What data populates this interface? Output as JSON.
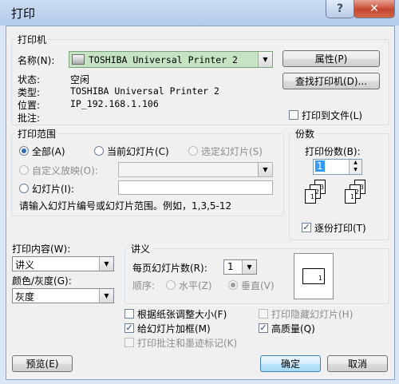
{
  "window": {
    "title": "打印"
  },
  "printer": {
    "group_label": "打印机",
    "name_label": "名称(N):",
    "name_value": "TOSHIBA Universal Printer 2",
    "properties_button": "属性(P)",
    "find_button": "查找打印机(D)...",
    "status_label": "状态:",
    "status_value": "空闲",
    "type_label": "类型:",
    "type_value": "TOSHIBA Universal Printer 2",
    "location_label": "位置:",
    "location_value": "IP_192.168.1.106",
    "comment_label": "批注:",
    "comment_value": "",
    "print_to_file": "打印到文件(L)"
  },
  "range": {
    "group_label": "打印范围",
    "all": "全部(A)",
    "current_slide": "当前幻灯片(C)",
    "selection": "选定幻灯片(S)",
    "custom_show": "自定义放映(O):",
    "slides": "幻灯片(I):",
    "hint": "请输入幻灯片编号或幻灯片范围。例如，1,3,5-12"
  },
  "copies": {
    "group_label": "份数",
    "count_label": "打印份数(B):",
    "count_value": "1",
    "collate": "逐份打印(T)",
    "collate_icon_pages": [
      "1",
      "2",
      "3"
    ]
  },
  "print_what": {
    "label": "打印内容(W):",
    "value": "讲义"
  },
  "color": {
    "label": "颜色/灰度(G):",
    "value": "灰度"
  },
  "handouts": {
    "group_label": "讲义",
    "per_page_label": "每页幻灯片数(R):",
    "per_page_value": "1",
    "order_label": "顺序:",
    "horizontal": "水平(Z)",
    "vertical": "垂直(V)",
    "preview_page_number": "1"
  },
  "options": {
    "scale_to_fit": "根据纸张调整大小(F)",
    "frame_slides": "给幻灯片加框(M)",
    "print_comments": "打印批注和墨迹标记(K)",
    "print_hidden": "打印隐藏幻灯片(H)",
    "high_quality": "高质量(Q)"
  },
  "footer": {
    "preview": "预览(E)",
    "ok": "确定",
    "cancel": "取消"
  }
}
